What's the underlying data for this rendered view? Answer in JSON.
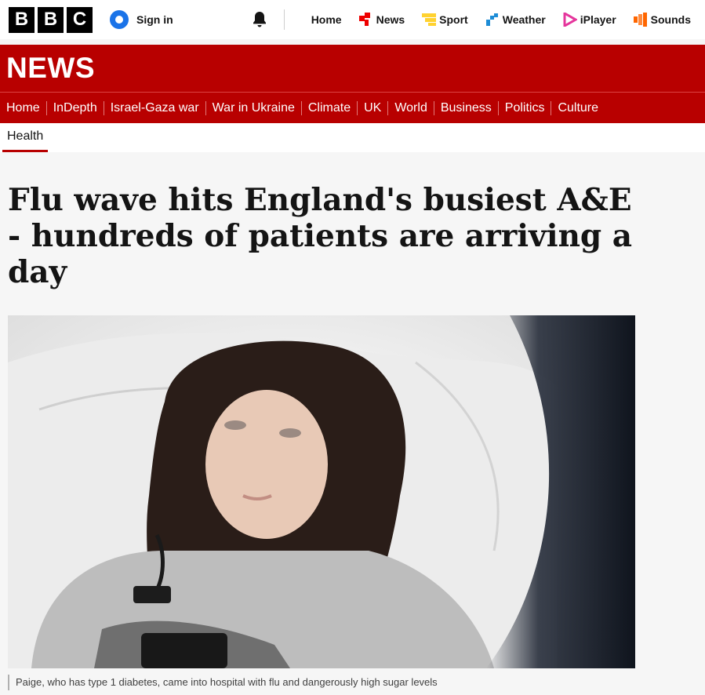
{
  "masthead": {
    "logo_letters": [
      "B",
      "B",
      "C"
    ],
    "signin_label": "Sign in",
    "nav": [
      {
        "label": "Home",
        "icon": "none"
      },
      {
        "label": "News",
        "icon": "news-icon",
        "color": "#ee0000"
      },
      {
        "label": "Sport",
        "icon": "sport-icon",
        "color": "#ffd230"
      },
      {
        "label": "Weather",
        "icon": "weather-icon",
        "color": "#1d8cd6"
      },
      {
        "label": "iPlayer",
        "icon": "iplayer-icon",
        "color": "#e5359c"
      },
      {
        "label": "Sounds",
        "icon": "sounds-icon",
        "color": "#ff6600"
      }
    ]
  },
  "newsbar": {
    "title": "NEWS",
    "sections": [
      "Home",
      "InDepth",
      "Israel-Gaza war",
      "War in Ukraine",
      "Climate",
      "UK",
      "World",
      "Business",
      "Politics",
      "Culture"
    ]
  },
  "subnav": {
    "active": "Health"
  },
  "article": {
    "headline": "Flu wave hits England's busiest A&E - hundreds of patients are arriving a day",
    "caption": "Paige, who has type 1 diabetes, came into hospital with flu and dangerously high sugar levels"
  },
  "colors": {
    "brand_red": "#b80000",
    "background": "#f6f6f6"
  }
}
